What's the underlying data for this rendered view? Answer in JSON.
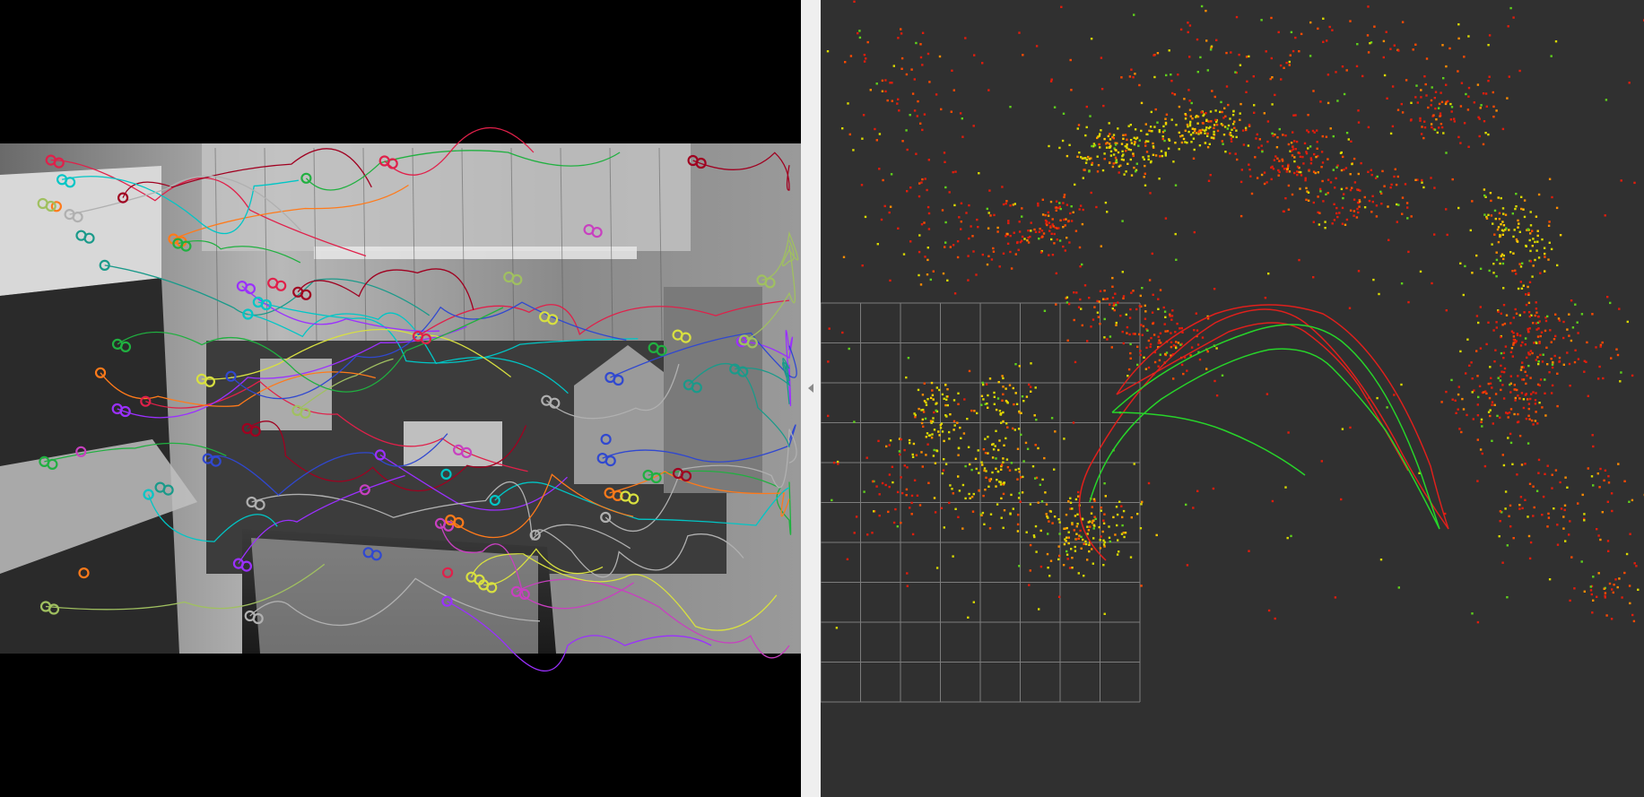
{
  "colors": {
    "camera_background": "#000000",
    "viz_background": "#303030",
    "splitter": "#efefef",
    "grid": "#8f8f8f",
    "trajectory_estimate": "#e0201c",
    "trajectory_ground_truth": "#27d52a",
    "landmark_palette": [
      "#d9d900",
      "#ffcc00",
      "#ff8c00",
      "#ff4a00",
      "#e21c0c",
      "#5fd01c"
    ],
    "feature_track_palette": [
      "#e0204a",
      "#9b30ff",
      "#00c6c6",
      "#d8e040",
      "#20b040",
      "#ff7a1a",
      "#b0b0b0",
      "#3048d0",
      "#c840c0",
      "#a0c060",
      "#a00020",
      "#1a9a8a"
    ]
  },
  "icons": {
    "splitter_handle": "collapse-arrow-icon"
  }
}
